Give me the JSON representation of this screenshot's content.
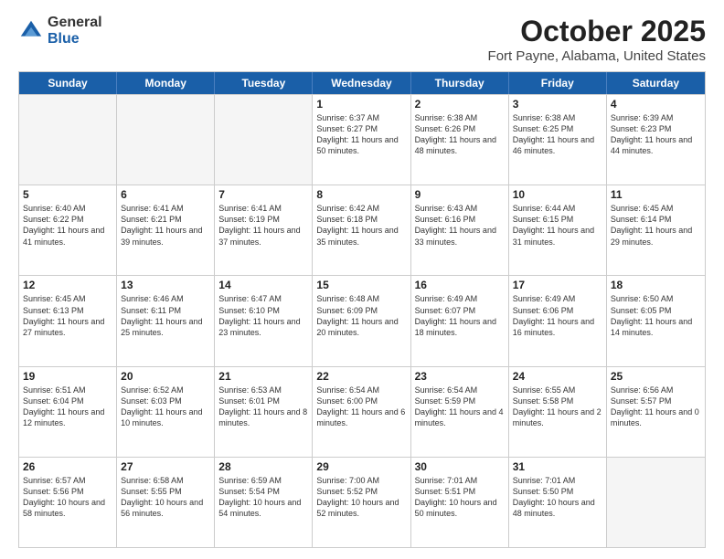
{
  "logo": {
    "general": "General",
    "blue": "Blue"
  },
  "title": "October 2025",
  "location": "Fort Payne, Alabama, United States",
  "headers": [
    "Sunday",
    "Monday",
    "Tuesday",
    "Wednesday",
    "Thursday",
    "Friday",
    "Saturday"
  ],
  "rows": [
    [
      {
        "day": "",
        "empty": true
      },
      {
        "day": "",
        "empty": true
      },
      {
        "day": "",
        "empty": true
      },
      {
        "day": "1",
        "rise": "6:37 AM",
        "set": "6:27 PM",
        "daylight": "11 hours and 50 minutes."
      },
      {
        "day": "2",
        "rise": "6:38 AM",
        "set": "6:26 PM",
        "daylight": "11 hours and 48 minutes."
      },
      {
        "day": "3",
        "rise": "6:38 AM",
        "set": "6:25 PM",
        "daylight": "11 hours and 46 minutes."
      },
      {
        "day": "4",
        "rise": "6:39 AM",
        "set": "6:23 PM",
        "daylight": "11 hours and 44 minutes."
      }
    ],
    [
      {
        "day": "5",
        "rise": "6:40 AM",
        "set": "6:22 PM",
        "daylight": "11 hours and 41 minutes."
      },
      {
        "day": "6",
        "rise": "6:41 AM",
        "set": "6:21 PM",
        "daylight": "11 hours and 39 minutes."
      },
      {
        "day": "7",
        "rise": "6:41 AM",
        "set": "6:19 PM",
        "daylight": "11 hours and 37 minutes."
      },
      {
        "day": "8",
        "rise": "6:42 AM",
        "set": "6:18 PM",
        "daylight": "11 hours and 35 minutes."
      },
      {
        "day": "9",
        "rise": "6:43 AM",
        "set": "6:16 PM",
        "daylight": "11 hours and 33 minutes."
      },
      {
        "day": "10",
        "rise": "6:44 AM",
        "set": "6:15 PM",
        "daylight": "11 hours and 31 minutes."
      },
      {
        "day": "11",
        "rise": "6:45 AM",
        "set": "6:14 PM",
        "daylight": "11 hours and 29 minutes."
      }
    ],
    [
      {
        "day": "12",
        "rise": "6:45 AM",
        "set": "6:13 PM",
        "daylight": "11 hours and 27 minutes."
      },
      {
        "day": "13",
        "rise": "6:46 AM",
        "set": "6:11 PM",
        "daylight": "11 hours and 25 minutes."
      },
      {
        "day": "14",
        "rise": "6:47 AM",
        "set": "6:10 PM",
        "daylight": "11 hours and 23 minutes."
      },
      {
        "day": "15",
        "rise": "6:48 AM",
        "set": "6:09 PM",
        "daylight": "11 hours and 20 minutes."
      },
      {
        "day": "16",
        "rise": "6:49 AM",
        "set": "6:07 PM",
        "daylight": "11 hours and 18 minutes."
      },
      {
        "day": "17",
        "rise": "6:49 AM",
        "set": "6:06 PM",
        "daylight": "11 hours and 16 minutes."
      },
      {
        "day": "18",
        "rise": "6:50 AM",
        "set": "6:05 PM",
        "daylight": "11 hours and 14 minutes."
      }
    ],
    [
      {
        "day": "19",
        "rise": "6:51 AM",
        "set": "6:04 PM",
        "daylight": "11 hours and 12 minutes."
      },
      {
        "day": "20",
        "rise": "6:52 AM",
        "set": "6:03 PM",
        "daylight": "11 hours and 10 minutes."
      },
      {
        "day": "21",
        "rise": "6:53 AM",
        "set": "6:01 PM",
        "daylight": "11 hours and 8 minutes."
      },
      {
        "day": "22",
        "rise": "6:54 AM",
        "set": "6:00 PM",
        "daylight": "11 hours and 6 minutes."
      },
      {
        "day": "23",
        "rise": "6:54 AM",
        "set": "5:59 PM",
        "daylight": "11 hours and 4 minutes."
      },
      {
        "day": "24",
        "rise": "6:55 AM",
        "set": "5:58 PM",
        "daylight": "11 hours and 2 minutes."
      },
      {
        "day": "25",
        "rise": "6:56 AM",
        "set": "5:57 PM",
        "daylight": "11 hours and 0 minutes."
      }
    ],
    [
      {
        "day": "26",
        "rise": "6:57 AM",
        "set": "5:56 PM",
        "daylight": "10 hours and 58 minutes."
      },
      {
        "day": "27",
        "rise": "6:58 AM",
        "set": "5:55 PM",
        "daylight": "10 hours and 56 minutes."
      },
      {
        "day": "28",
        "rise": "6:59 AM",
        "set": "5:54 PM",
        "daylight": "10 hours and 54 minutes."
      },
      {
        "day": "29",
        "rise": "7:00 AM",
        "set": "5:52 PM",
        "daylight": "10 hours and 52 minutes."
      },
      {
        "day": "30",
        "rise": "7:01 AM",
        "set": "5:51 PM",
        "daylight": "10 hours and 50 minutes."
      },
      {
        "day": "31",
        "rise": "7:01 AM",
        "set": "5:50 PM",
        "daylight": "10 hours and 48 minutes."
      },
      {
        "day": "",
        "empty": true
      }
    ]
  ]
}
